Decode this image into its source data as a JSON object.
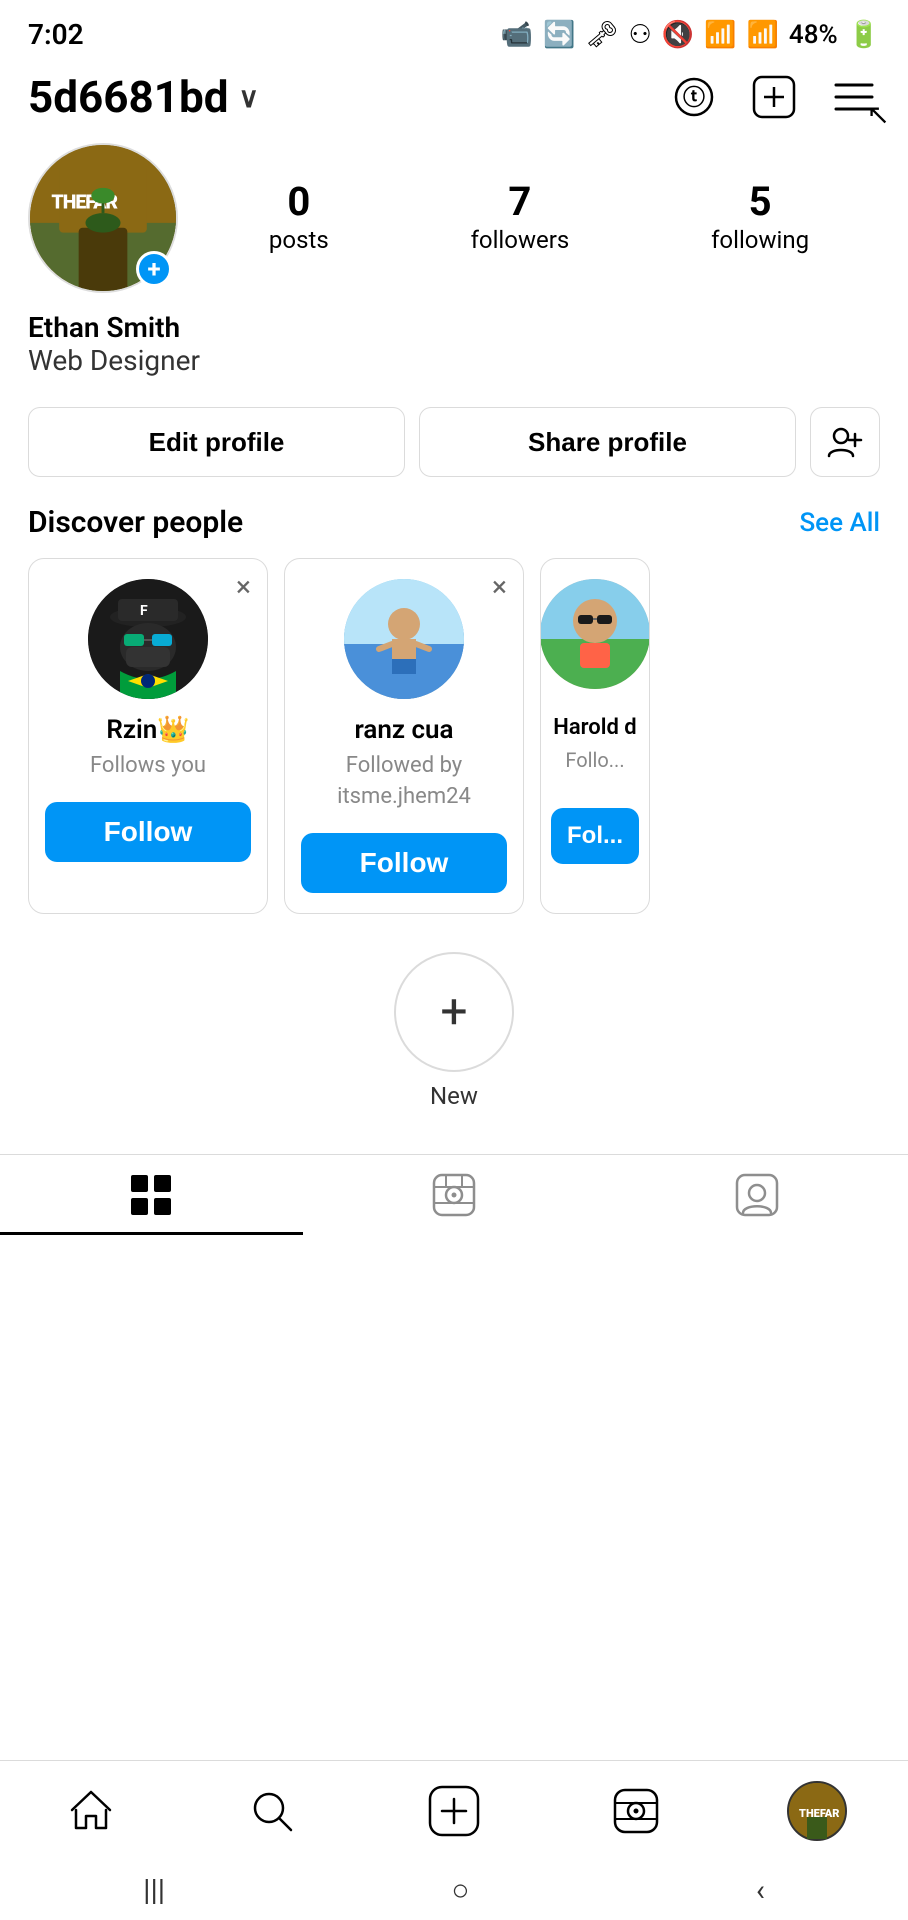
{
  "status_bar": {
    "time": "7:02",
    "battery": "48%",
    "signal_icons": "📹 🔄 ⟲"
  },
  "header": {
    "username": "5d6681bd",
    "threads_icon": "Ⓣ",
    "add_icon": "⊕",
    "menu_icon": "☰"
  },
  "profile": {
    "name": "Ethan Smith",
    "bio": "Web Designer",
    "posts_count": "0",
    "posts_label": "posts",
    "followers_count": "7",
    "followers_label": "followers",
    "following_count": "5",
    "following_label": "following"
  },
  "action_buttons": {
    "edit_label": "Edit profile",
    "share_label": "Share profile",
    "add_person_icon": "👤+"
  },
  "discover": {
    "title": "Discover people",
    "see_all": "See All",
    "cards": [
      {
        "username": "Rzin👑",
        "subtitle": "Follows you",
        "follow_label": "Follow"
      },
      {
        "username": "ranz cua",
        "subtitle": "Followed by itsme.jhem24",
        "follow_label": "Follow"
      },
      {
        "username": "Harold d",
        "subtitle": "Followed by dking...",
        "follow_label": "Fol..."
      }
    ]
  },
  "highlights": {
    "new_label": "New"
  },
  "tabs": {
    "grid_icon": "⊞",
    "reels_icon": "▶",
    "tagged_icon": "🏷"
  },
  "bottom_nav": {
    "home_icon": "⌂",
    "search_icon": "🔍",
    "add_icon": "+",
    "reels_icon": "▶",
    "profile_label": "profile"
  },
  "system_nav": {
    "back": "‹",
    "home": "○",
    "recent": "|||"
  }
}
